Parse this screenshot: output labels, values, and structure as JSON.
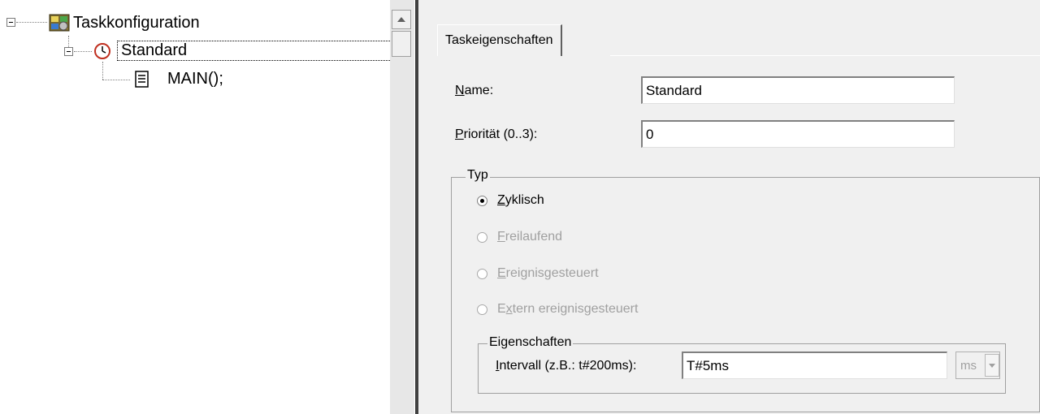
{
  "tree": {
    "root": {
      "label": "Taskkonfiguration",
      "icon": "task-config-icon"
    },
    "task": {
      "label": "Standard",
      "icon": "clock-icon"
    },
    "program": {
      "label": "MAIN();",
      "icon": "document-icon"
    }
  },
  "properties": {
    "tab_label": "Taskeigenschaften",
    "name": {
      "mnemonic": "N",
      "rest": "ame:",
      "value": "Standard"
    },
    "priority": {
      "mnemonic": "P",
      "rest": "riorität (0..3):",
      "value": "0"
    },
    "type_group": {
      "title": "Typ",
      "options": [
        {
          "mnemonic": "Z",
          "rest": "yklisch",
          "selected": true,
          "enabled": true
        },
        {
          "mnemonic": "F",
          "rest": "reilaufend",
          "selected": false,
          "enabled": false
        },
        {
          "mnemonic": "E",
          "rest": "reignisgesteuert",
          "selected": false,
          "enabled": false
        },
        {
          "pre": "E",
          "mnemonic": "x",
          "rest": "tern ereignisgesteuert",
          "selected": false,
          "enabled": false
        }
      ]
    },
    "properties_group": {
      "title": "Eigenschaften",
      "interval": {
        "mnemonic": "I",
        "rest": "ntervall (z.B.: t#200ms):",
        "value": "T#5ms",
        "unit": "ms"
      }
    }
  }
}
